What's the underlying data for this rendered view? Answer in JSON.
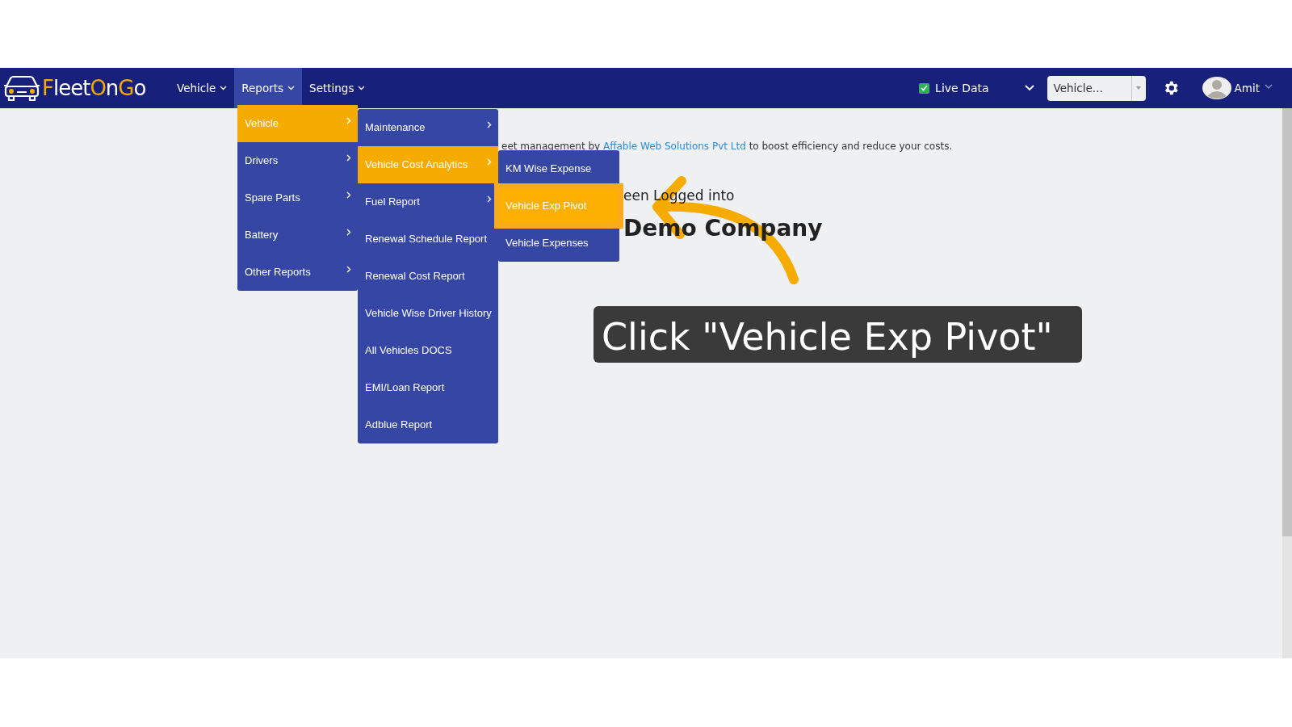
{
  "navbar": {
    "logo": {
      "parts": [
        {
          "text": "F",
          "accent": true
        },
        {
          "text": "leet",
          "accent": false
        },
        {
          "text": "O",
          "accent": true
        },
        {
          "text": "n",
          "accent": false
        },
        {
          "text": "G",
          "accent": true
        },
        {
          "text": "o",
          "accent": false
        }
      ]
    },
    "menu": [
      {
        "label": "Vehicle",
        "selected": false
      },
      {
        "label": "Reports",
        "selected": true
      },
      {
        "label": "Settings",
        "selected": false
      }
    ],
    "live_data": {
      "label": "Live Data",
      "checked": true
    },
    "vehicle_select": {
      "value": "Vehicle..."
    },
    "user": {
      "name": "Amit"
    }
  },
  "dropdown": {
    "level_1": [
      {
        "label": "Vehicle",
        "selected": true,
        "has_submenu": true
      },
      {
        "label": "Drivers",
        "selected": false,
        "has_submenu": true
      },
      {
        "label": "Spare Parts",
        "selected": false,
        "has_submenu": true
      },
      {
        "label": "Battery",
        "selected": false,
        "has_submenu": true
      },
      {
        "label": "Other Reports",
        "selected": false,
        "has_submenu": true
      }
    ],
    "level_2": [
      {
        "label": "Maintenance",
        "selected": false,
        "has_submenu": true
      },
      {
        "label": "Vehicle Cost Analytics",
        "selected": true,
        "has_submenu": true
      },
      {
        "label": "Fuel Report",
        "selected": false,
        "has_submenu": true
      },
      {
        "label": "Renewal Schedule Report",
        "selected": false,
        "has_submenu": false
      },
      {
        "label": "Renewal Cost Report",
        "selected": false,
        "has_submenu": false
      },
      {
        "label": "Vehicle Wise Driver History",
        "selected": false,
        "has_submenu": false
      },
      {
        "label": "All Vehicles DOCS",
        "selected": false,
        "has_submenu": false
      },
      {
        "label": "EMI/Loan Report",
        "selected": false,
        "has_submenu": false
      },
      {
        "label": "Adblue Report",
        "selected": false,
        "has_submenu": false
      }
    ],
    "level_3": [
      {
        "label": "KM Wise Expense",
        "selected": false,
        "has_submenu": false
      },
      {
        "label": "Vehicle Exp Pivot",
        "selected": true,
        "has_submenu": false
      },
      {
        "label": "Vehicle Expenses",
        "selected": false,
        "has_submenu": false
      }
    ]
  },
  "intro": {
    "text_before": "eet management by ",
    "link": "Affable Web Solutions Pvt Ltd",
    "text_after": " to boost efficiency and reduce your costs."
  },
  "welcome": {
    "line": "een Logged into",
    "company": "Demo Company"
  },
  "callout": {
    "text": "Click \"Vehicle Exp Pivot\""
  }
}
